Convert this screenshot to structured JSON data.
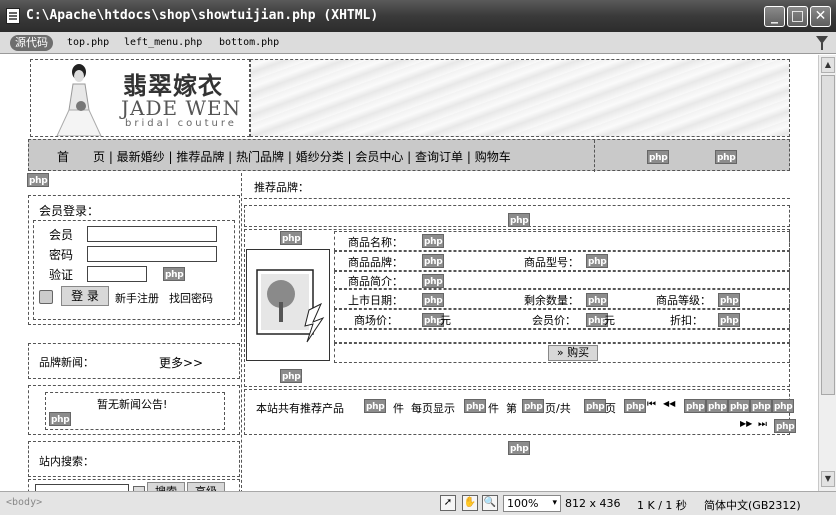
{
  "window": {
    "title": "C:\\Apache\\htdocs\\shop\\showtuijian.php (XHTML)"
  },
  "toolbar": {
    "source_label": "源代码",
    "files": [
      "top.php",
      "left_menu.php",
      "bottom.php"
    ]
  },
  "php_marker": "php",
  "logo": {
    "cn": "翡翠嫁衣",
    "en": "JADE WEN",
    "sub": "bridal couture"
  },
  "nav": {
    "text": "首　　页 | 最新婚纱 | 推荐品牌 | 热门品牌 | 婚纱分类 | 会员中心 | 查询订单 | 购物车"
  },
  "left": {
    "login_title": "会员登录：",
    "member_label": "会员",
    "password_label": "密码",
    "verify_label": "验证",
    "login_button": "登 录",
    "register_link": "新手注册",
    "recover_link": "找回密码",
    "brand_news_title": "品牌新闻：",
    "more_link": "更多>>",
    "no_news": "暂无新闻公告!",
    "search_title": "站内搜索：",
    "search_button": "搜索",
    "advanced_button": "高级"
  },
  "main": {
    "section_title": "推荐品牌：",
    "product_name_label": "商品名称：",
    "brand_label": "商品品牌：",
    "model_label": "商品型号：",
    "intro_label": "商品简介：",
    "date_label": "上市日期：",
    "stock_label": "剩余数量：",
    "grade_label": "商品等级：",
    "market_price_label": "商场价：",
    "member_price_label": "会员价：",
    "discount_label": "折扣：",
    "yuan": "元",
    "buy_button": "» 购买",
    "pager_prefix": "本站共有推荐产品",
    "pager_piece": "件",
    "pager_perpage": "每页显示",
    "pager_piece2": "件",
    "pager_di": "第",
    "pager_page_of": "页/共",
    "pager_page": "页",
    "nav_first": "⏮",
    "nav_prev": "◀◀",
    "nav_next": "▶▶",
    "nav_last": "⏭"
  },
  "status": {
    "tag": "<body>",
    "zoom": "100%",
    "size": "812 x 436",
    "filesize": "1 K / 1 秒",
    "encoding": "简体中文(GB2312)"
  }
}
